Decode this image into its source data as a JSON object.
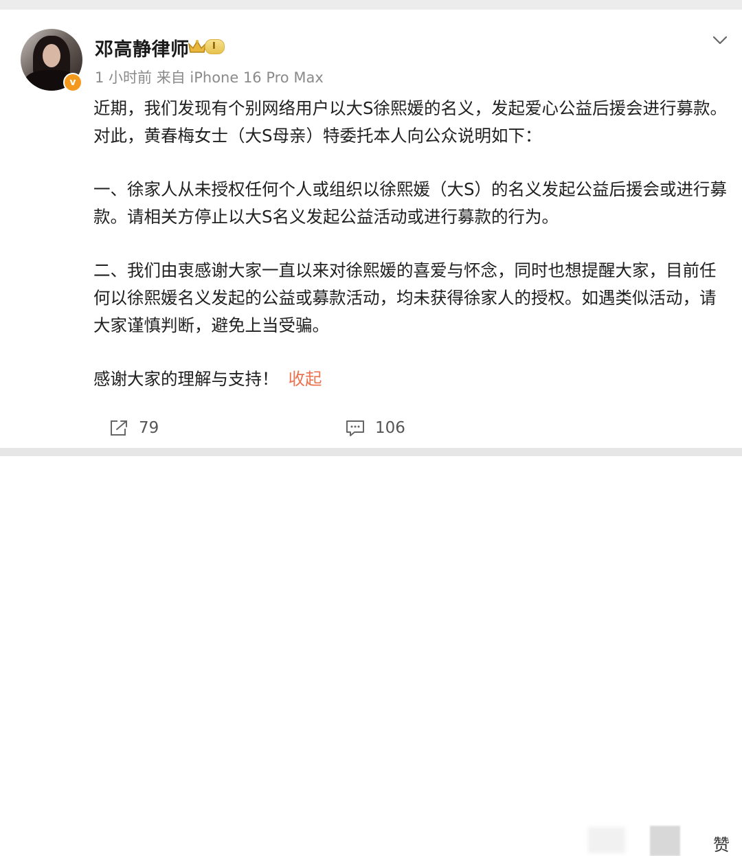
{
  "post": {
    "author": "邓高静律师",
    "level_badge": "I",
    "verified_mark": "v",
    "meta": "1 小时前  来自 iPhone 16 Pro Max",
    "paragraphs": [
      "近期，我们发现有个别网络用户以大S徐熙媛的名义，发起爱心公益后援会进行募款。对此，黄春梅女士（大S母亲）特委托本人向公众说明如下：",
      "一、徐家人从未授权任何个人或组织以徐熙媛（大S）的名义发起公益后援会或进行募款。请相关方停止以大S名义发起公益活动或进行募款的行为。",
      "二、我们由衷感谢大家一直以来对徐熙媛的喜爱与怀念，同时也想提醒大家，目前任何以徐熙媛名义发起的公益或募款活动，均未获得徐家人的授权。如遇类似活动，请大家谨慎判断，避免上当受骗。",
      "感谢大家的理解与支持！"
    ],
    "collapse_label": "收起",
    "actions": {
      "repost_count": "79",
      "comment_count": "106"
    },
    "partial_glyph": "赞"
  },
  "colors": {
    "accent_orange": "#eb7350",
    "verified_orange": "#f39a1e",
    "meta_gray": "#8a8a8a"
  },
  "icons": [
    "crown-icon",
    "chevron-down-icon",
    "repost-icon",
    "comment-icon"
  ]
}
